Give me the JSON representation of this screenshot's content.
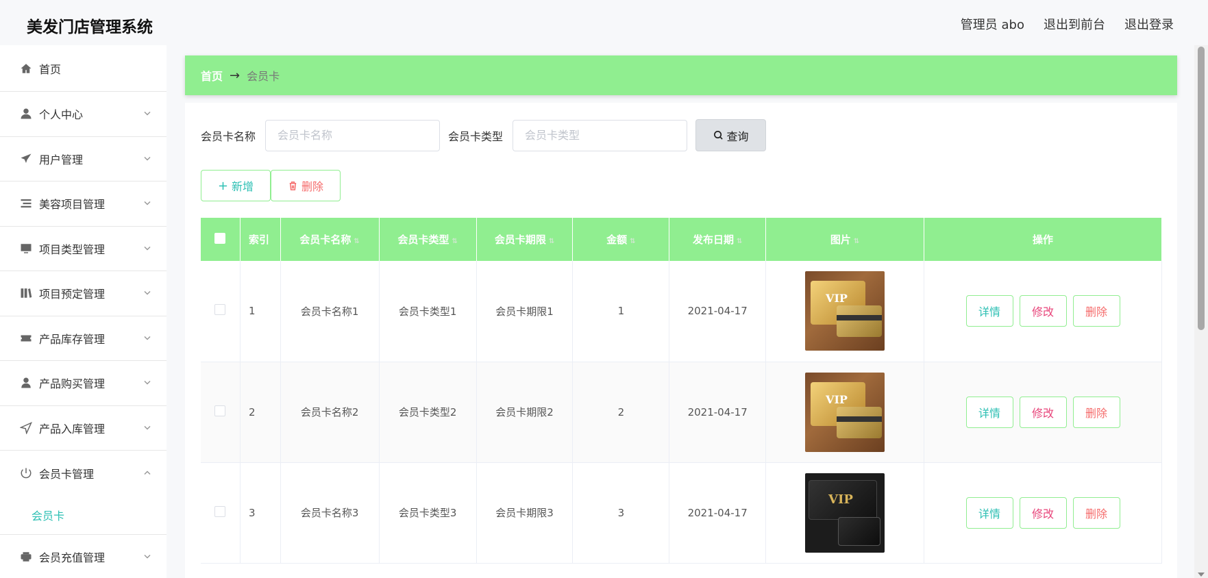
{
  "app": {
    "title": "美发门店管理系统"
  },
  "topnav": {
    "user": "管理员 abo",
    "to_front": "退出到前台",
    "logout": "退出登录"
  },
  "sidebar": {
    "items": [
      {
        "label": "首页",
        "icon": "home-icon"
      },
      {
        "label": "个人中心",
        "icon": "user-icon"
      },
      {
        "label": "用户管理",
        "icon": "send-icon"
      },
      {
        "label": "美容项目管理",
        "icon": "list-icon"
      },
      {
        "label": "项目类型管理",
        "icon": "monitor-icon"
      },
      {
        "label": "项目预定管理",
        "icon": "library-icon"
      },
      {
        "label": "产品库存管理",
        "icon": "ticket-icon"
      },
      {
        "label": "产品购买管理",
        "icon": "person-icon"
      },
      {
        "label": "产品入库管理",
        "icon": "location-icon"
      },
      {
        "label": "会员卡管理",
        "icon": "power-icon"
      },
      {
        "label": "会员充值管理",
        "icon": "printer-icon"
      }
    ],
    "sub_item": "会员卡"
  },
  "breadcrumb": {
    "home": "首页",
    "separator": "→",
    "current": "会员卡"
  },
  "search": {
    "name_label": "会员卡名称",
    "name_placeholder": "会员卡名称",
    "type_label": "会员卡类型",
    "type_placeholder": "会员卡类型",
    "query_label": "查询"
  },
  "actions": {
    "add_label": "新增",
    "delete_label": "删除"
  },
  "table": {
    "headers": [
      "索引",
      "会员卡名称",
      "会员卡类型",
      "会员卡期限",
      "金额",
      "发布日期",
      "图片",
      "操作"
    ],
    "rows": [
      {
        "index": "1",
        "name": "会员卡名称1",
        "type": "会员卡类型1",
        "term": "会员卡期限1",
        "amount": "1",
        "date": "2021-04-17",
        "image": "gold-vip-card"
      },
      {
        "index": "2",
        "name": "会员卡名称2",
        "type": "会员卡类型2",
        "term": "会员卡期限2",
        "amount": "2",
        "date": "2021-04-17",
        "image": "gold-vip-card"
      },
      {
        "index": "3",
        "name": "会员卡名称3",
        "type": "会员卡类型3",
        "term": "会员卡期限3",
        "amount": "3",
        "date": "2021-04-17",
        "image": "black-vip-card"
      }
    ],
    "row_actions": {
      "detail": "详情",
      "edit": "修改",
      "delete": "删除"
    }
  },
  "images": {
    "vip_text": "VIP"
  },
  "colors": {
    "accent_green": "#90ee90",
    "teal": "#2bbfb3",
    "pink": "#e8447a",
    "red": "#f56c6c"
  }
}
